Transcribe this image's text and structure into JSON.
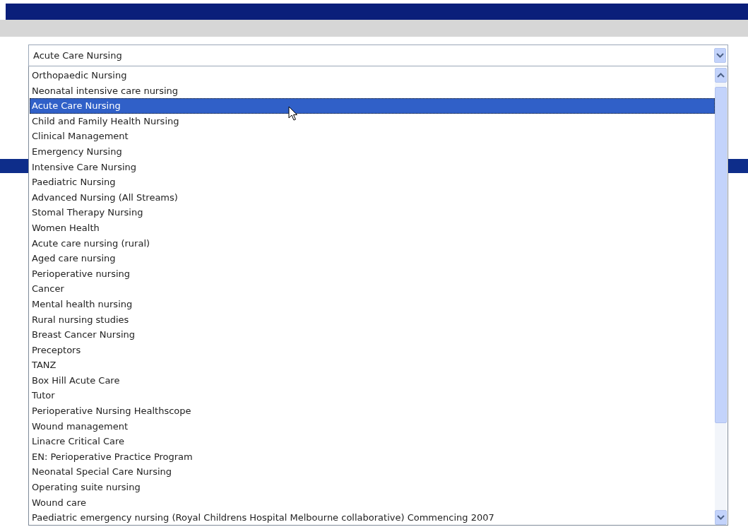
{
  "dropdown": {
    "value": "Acute Care Nursing",
    "options": [
      {
        "label": "Orthopaedic Nursing",
        "selected": false
      },
      {
        "label": "Neonatal intensive care nursing",
        "selected": false
      },
      {
        "label": "Acute Care Nursing",
        "selected": true
      },
      {
        "label": "Child and Family Health Nursing",
        "selected": false
      },
      {
        "label": "Clinical Management",
        "selected": false
      },
      {
        "label": "Emergency Nursing",
        "selected": false
      },
      {
        "label": "Intensive Care Nursing",
        "selected": false
      },
      {
        "label": "Paediatric Nursing",
        "selected": false
      },
      {
        "label": "Advanced Nursing (All Streams)",
        "selected": false
      },
      {
        "label": "Stomal Therapy Nursing",
        "selected": false
      },
      {
        "label": "Women Health",
        "selected": false
      },
      {
        "label": "Acute care nursing (rural)",
        "selected": false
      },
      {
        "label": "Aged care nursing",
        "selected": false
      },
      {
        "label": "Perioperative nursing",
        "selected": false
      },
      {
        "label": "Cancer",
        "selected": false
      },
      {
        "label": "Mental health nursing",
        "selected": false
      },
      {
        "label": "Rural nursing studies",
        "selected": false
      },
      {
        "label": "Breast Cancer Nursing",
        "selected": false
      },
      {
        "label": "Preceptors",
        "selected": false
      },
      {
        "label": "TANZ",
        "selected": false
      },
      {
        "label": "Box Hill Acute Care",
        "selected": false
      },
      {
        "label": "Tutor",
        "selected": false
      },
      {
        "label": "Perioperative Nursing Healthscope",
        "selected": false
      },
      {
        "label": "Wound management",
        "selected": false
      },
      {
        "label": "Linacre Critical Care",
        "selected": false
      },
      {
        "label": "EN: Perioperative Practice Program",
        "selected": false
      },
      {
        "label": "Neonatal Special Care Nursing",
        "selected": false
      },
      {
        "label": "Operating suite nursing",
        "selected": false
      },
      {
        "label": "Wound care",
        "selected": false
      },
      {
        "label": "Paediatric emergency nursing (Royal Childrens Hospital Melbourne collaborative) Commencing 2007",
        "selected": false
      }
    ]
  }
}
